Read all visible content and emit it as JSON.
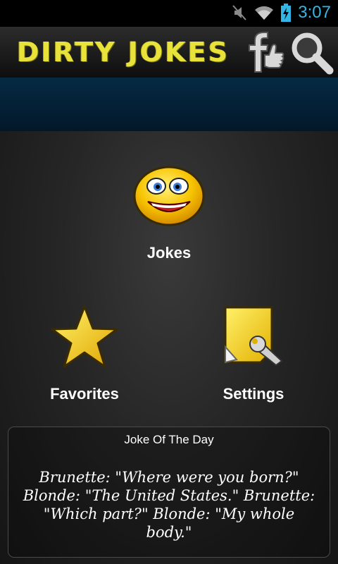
{
  "status_bar": {
    "time": "3:07"
  },
  "app_bar": {
    "title": "DIRTY JOKES"
  },
  "menu": {
    "jokes_label": "Jokes",
    "favorites_label": "Favorites",
    "settings_label": "Settings"
  },
  "joke_of_the_day": {
    "title": "Joke Of The Day",
    "text": "Brunette: \"Where were you born?\" Blonde: \"The United States.\" Brunette: \"Which part?\" Blonde: \"My whole body.\""
  },
  "colors": {
    "status_accent": "#33b5e5",
    "title_yellow": "#e8e23a",
    "banner_blue": "#062a44"
  }
}
